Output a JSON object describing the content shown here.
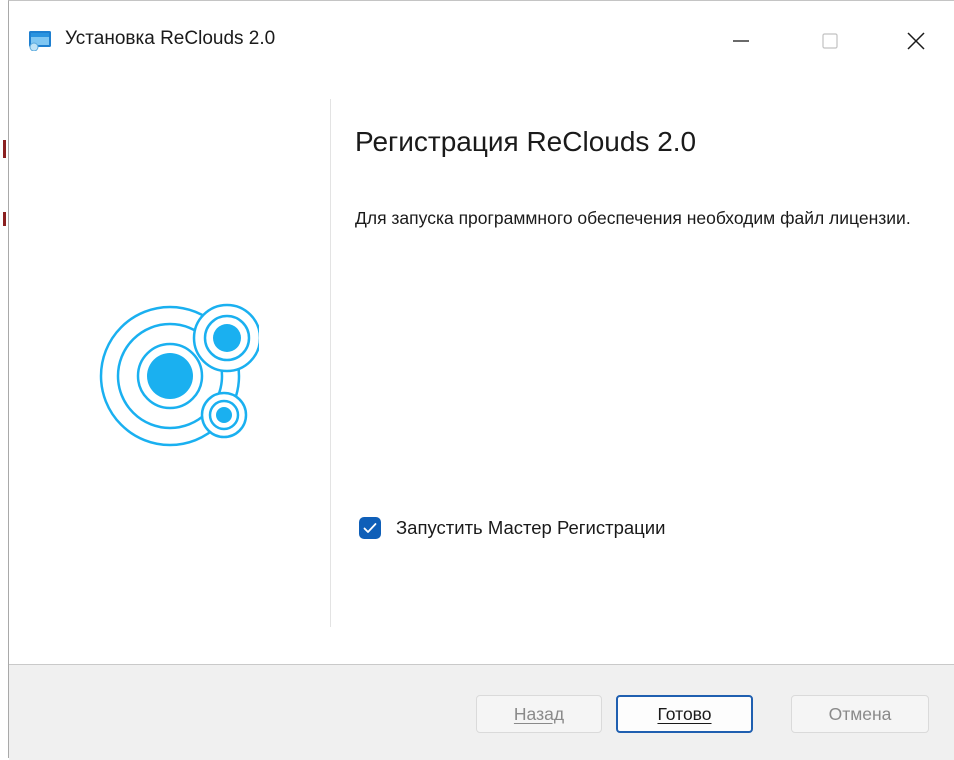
{
  "window": {
    "title": "Установка ReClouds 2.0",
    "controls": {
      "minimize": "minimize",
      "maximize": "maximize",
      "close": "close"
    }
  },
  "content": {
    "heading": "Регистрация ReClouds 2.0",
    "description": "Для запуска программного обеспечения необходим файл лицензии.",
    "checkbox": {
      "label": "Запустить Мастер Регистрации",
      "checked": true
    }
  },
  "footer": {
    "back_label": "Назад",
    "finish_label": "Готово",
    "cancel_label": "Отмена"
  },
  "colors": {
    "accent": "#0f5fb8",
    "logo": "#1ab0f0"
  },
  "icons": {
    "app": "installer-icon",
    "logo": "reclouds-logo"
  }
}
